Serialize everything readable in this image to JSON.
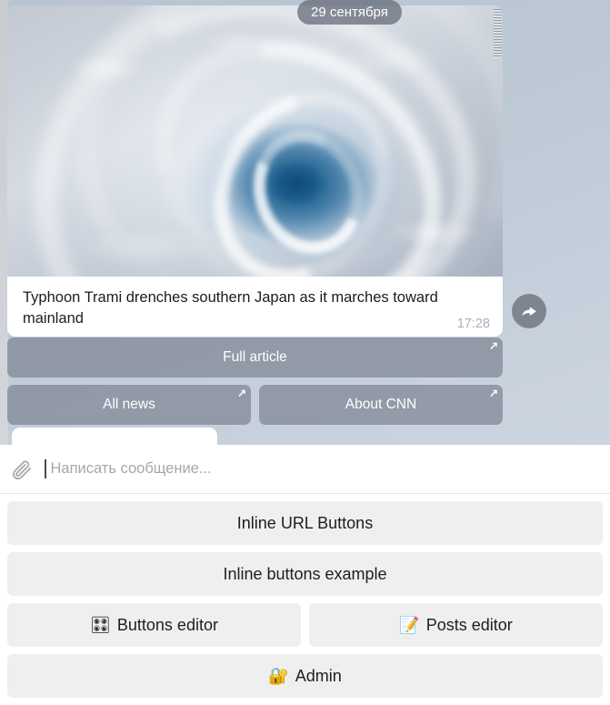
{
  "chat": {
    "date_badge": "29 сентября",
    "message": {
      "caption": "Typhoon Trami drenches southern Japan as it marches toward mainland",
      "time": "17:28",
      "photo_alt": "typhoon-satellite-photo",
      "forward_icon": "forward-arrow-icon",
      "attachment_watermark": "photo-credit-watermark"
    },
    "inline_keyboard": {
      "link_arrow": "↗",
      "rows": [
        [
          {
            "label": "Full article",
            "type": "url"
          }
        ],
        [
          {
            "label": "All news",
            "type": "url"
          },
          {
            "label": "About CNN",
            "type": "url"
          }
        ]
      ]
    }
  },
  "input_bar": {
    "attach_icon": "paperclip-icon",
    "value": "",
    "placeholder": "Написать сообщение..."
  },
  "reply_keyboard": {
    "rows": [
      [
        {
          "label": "Inline URL Buttons",
          "emoji": ""
        }
      ],
      [
        {
          "label": "Inline buttons example",
          "emoji": ""
        }
      ],
      [
        {
          "label": "Buttons editor",
          "emoji": "🎛"
        },
        {
          "label": "Posts editor",
          "emoji": "📝"
        }
      ],
      [
        {
          "label": "Admin",
          "emoji": "🔐"
        }
      ]
    ]
  },
  "colors": {
    "chat_bg_top": "#b9c4d2",
    "chat_bg_bottom": "#ccd5df",
    "inline_button": "#7e8594",
    "reply_button": "#efefef",
    "time_text": "#a3b1c0",
    "placeholder_text": "#a7a7a7"
  }
}
